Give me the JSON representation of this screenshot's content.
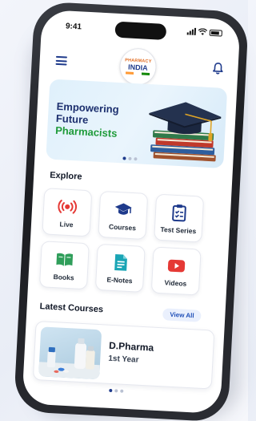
{
  "status_bar": {
    "time": "9:41"
  },
  "header": {
    "logo": {
      "line1": "PHARMACY",
      "line2": "INDIA"
    },
    "menu_icon": "hamburger-menu-icon",
    "notification_icon": "bell-icon"
  },
  "banner": {
    "lines": [
      "Empowering",
      "Future",
      "Pharmacists"
    ],
    "colors": {
      "primary": "#1c2f6e",
      "accent": "#1f9b3a"
    },
    "image": "graduation-cap-on-books",
    "pager": {
      "count": 3,
      "active": 1
    }
  },
  "explore": {
    "title": "Explore",
    "items": [
      {
        "label": "Live",
        "icon": "live-broadcast-icon"
      },
      {
        "label": "Courses",
        "icon": "graduation-cap-icon"
      },
      {
        "label": "Test Series",
        "icon": "clipboard-checklist-icon"
      },
      {
        "label": "Books",
        "icon": "open-book-icon"
      },
      {
        "label": "E-Notes",
        "icon": "document-icon"
      },
      {
        "label": "Videos",
        "icon": "play-button-icon"
      }
    ]
  },
  "latest_courses": {
    "title": "Latest Courses",
    "view_all_label": "View All",
    "courses": [
      {
        "name": "D.Pharma",
        "year": "1st Year",
        "image": "pharmacy-bottles-thumbnail"
      }
    ],
    "pager": {
      "count": 3,
      "active": 1
    }
  }
}
